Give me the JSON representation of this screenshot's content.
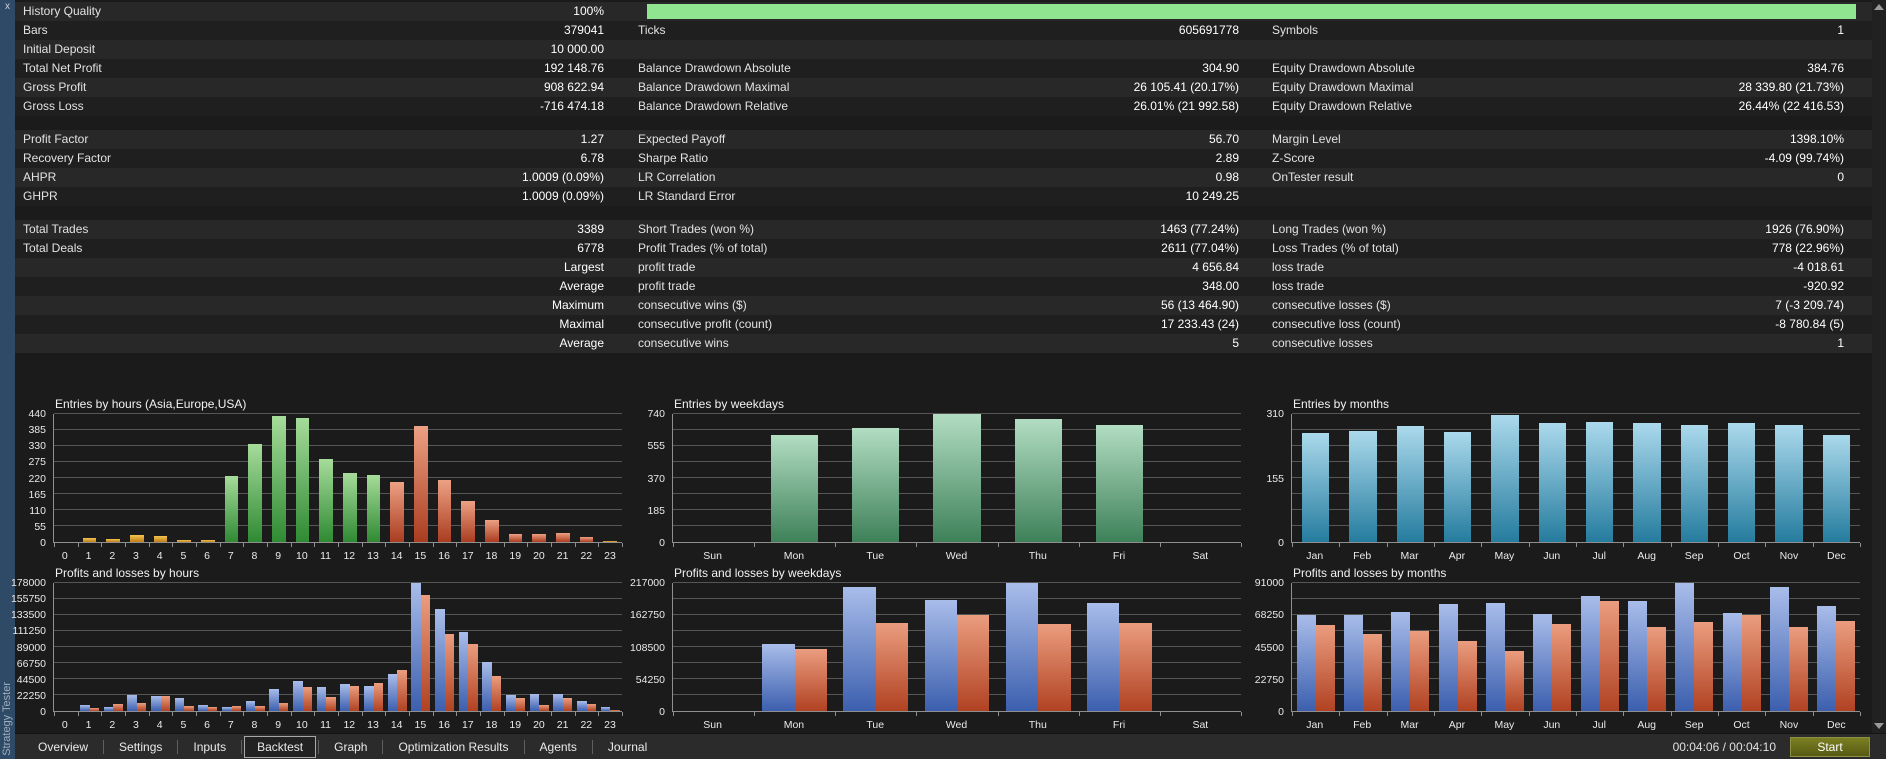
{
  "panel": {
    "title": "Strategy Tester",
    "close_icon": "x"
  },
  "colors": {
    "progress": "#90e690",
    "start_button_top": "#7b7f22",
    "start_button_bottom": "#565a13",
    "bars": {
      "orange": [
        "#f4c551",
        "#bd7d17"
      ],
      "green": [
        "#a6dc9a",
        "#2f8a33"
      ],
      "salmon": [
        "#eda184",
        "#aa3c20"
      ],
      "teal": [
        "#b2ddc2",
        "#3e8159"
      ],
      "cyan": [
        "#abd9ec",
        "#257c9e"
      ],
      "blue": [
        "#a9bdea",
        "#3c5fae"
      ],
      "red": [
        "#eb9d7f",
        "#b04222"
      ]
    }
  },
  "stats": {
    "rows": [
      {
        "progress": true,
        "c1": [
          "History Quality",
          "100%"
        ],
        "c2": [
          "",
          ""
        ],
        "c3": [
          "",
          ""
        ]
      },
      {
        "c1": [
          "Bars",
          "379041"
        ],
        "c2": [
          "Ticks",
          "605691778"
        ],
        "c3": [
          "Symbols",
          "1"
        ]
      },
      {
        "c1": [
          "Initial Deposit",
          "10 000.00"
        ],
        "c2": [
          "",
          ""
        ],
        "c3": [
          "",
          ""
        ]
      },
      {
        "c1": [
          "Total Net Profit",
          "192 148.76"
        ],
        "c2": [
          "Balance Drawdown Absolute",
          "304.90"
        ],
        "c3": [
          "Equity Drawdown Absolute",
          "384.76"
        ]
      },
      {
        "c1": [
          "Gross Profit",
          "908 622.94"
        ],
        "c2": [
          "Balance Drawdown Maximal",
          "26 105.41 (20.17%)"
        ],
        "c3": [
          "Equity Drawdown Maximal",
          "28 339.80 (21.73%)"
        ]
      },
      {
        "c1": [
          "Gross Loss",
          "-716 474.18"
        ],
        "c2": [
          "Balance Drawdown Relative",
          "26.01% (21 992.58)"
        ],
        "c3": [
          "Equity Drawdown Relative",
          "26.44% (22 416.53)"
        ]
      },
      {
        "gap": true
      },
      {
        "c1": [
          "Profit Factor",
          "1.27"
        ],
        "c2": [
          "Expected Payoff",
          "56.70"
        ],
        "c3": [
          "Margin Level",
          "1398.10%"
        ]
      },
      {
        "c1": [
          "Recovery Factor",
          "6.78"
        ],
        "c2": [
          "Sharpe Ratio",
          "2.89"
        ],
        "c3": [
          "Z-Score",
          "-4.09 (99.74%)"
        ]
      },
      {
        "c1": [
          "AHPR",
          "1.0009 (0.09%)"
        ],
        "c2": [
          "LR Correlation",
          "0.98"
        ],
        "c3": [
          "OnTester result",
          "0"
        ]
      },
      {
        "c1": [
          "GHPR",
          "1.0009 (0.09%)"
        ],
        "c2": [
          "LR Standard Error",
          "10 249.25"
        ],
        "c3": [
          "",
          ""
        ]
      },
      {
        "gap": true
      },
      {
        "c1": [
          "Total Trades",
          "3389"
        ],
        "c2": [
          "Short Trades (won %)",
          "1463 (77.24%)"
        ],
        "c3": [
          "Long Trades (won %)",
          "1926 (76.90%)"
        ]
      },
      {
        "c1": [
          "Total Deals",
          "6778"
        ],
        "c2": [
          "Profit Trades (% of total)",
          "2611 (77.04%)"
        ],
        "c3": [
          "Loss Trades (% of total)",
          "778 (22.96%)"
        ]
      },
      {
        "c1": [
          "",
          "Largest"
        ],
        "c2": [
          "profit trade",
          "4 656.84"
        ],
        "c3": [
          "loss trade",
          "-4 018.61"
        ]
      },
      {
        "c1": [
          "",
          "Average"
        ],
        "c2": [
          "profit trade",
          "348.00"
        ],
        "c3": [
          "loss trade",
          "-920.92"
        ]
      },
      {
        "c1": [
          "",
          "Maximum"
        ],
        "c2": [
          "consecutive wins ($)",
          "56 (13 464.90)"
        ],
        "c3": [
          "consecutive losses ($)",
          "7 (-3 209.74)"
        ]
      },
      {
        "c1": [
          "",
          "Maximal"
        ],
        "c2": [
          "consecutive profit (count)",
          "17 233.43 (24)"
        ],
        "c3": [
          "consecutive loss (count)",
          "-8 780.84 (5)"
        ]
      },
      {
        "c1": [
          "",
          "Average"
        ],
        "c2": [
          "consecutive wins",
          "5"
        ],
        "c3": [
          "consecutive losses",
          "1"
        ]
      }
    ]
  },
  "chart_data": [
    {
      "type": "bar",
      "title": "Entries by hours (Asia,Europe,USA)",
      "categories": [
        "0",
        "1",
        "2",
        "3",
        "4",
        "5",
        "6",
        "7",
        "8",
        "9",
        "10",
        "11",
        "12",
        "13",
        "14",
        "15",
        "16",
        "17",
        "18",
        "19",
        "20",
        "21",
        "22",
        "23"
      ],
      "values": [
        0,
        15,
        10,
        25,
        22,
        7,
        8,
        228,
        338,
        432,
        428,
        287,
        238,
        230,
        205,
        400,
        212,
        140,
        75,
        28,
        27,
        32,
        18,
        5
      ],
      "bar_colors": [
        "orange",
        "orange",
        "orange",
        "orange",
        "orange",
        "orange",
        "orange",
        "green",
        "green",
        "green",
        "green",
        "green",
        "green",
        "green",
        "salmon",
        "salmon",
        "salmon",
        "salmon",
        "salmon",
        "salmon",
        "salmon",
        "salmon",
        "salmon",
        "orange"
      ],
      "ymax": 440,
      "yticks": [
        0,
        55,
        110,
        165,
        220,
        275,
        330,
        385,
        440
      ],
      "grid_divisions": 8
    },
    {
      "type": "bar",
      "title": "Entries by weekdays",
      "categories": [
        "Sun",
        "Mon",
        "Tue",
        "Wed",
        "Thu",
        "Fri",
        "Sat"
      ],
      "values": [
        0,
        620,
        660,
        740,
        712,
        675,
        0
      ],
      "color": "teal",
      "ymax": 740,
      "yticks": [
        0,
        185,
        370,
        555,
        740
      ],
      "grid_divisions": 8
    },
    {
      "type": "bar",
      "title": "Entries by months",
      "categories": [
        "Jan",
        "Feb",
        "Mar",
        "Apr",
        "May",
        "Jun",
        "Jul",
        "Aug",
        "Sep",
        "Oct",
        "Nov",
        "Dec"
      ],
      "values": [
        265,
        268,
        282,
        266,
        308,
        288,
        291,
        288,
        284,
        289,
        283,
        260
      ],
      "color": "cyan",
      "ymax": 310,
      "yticks": [
        0,
        155,
        310
      ],
      "grid_divisions": 8
    },
    {
      "type": "bar",
      "title": "Profits and losses by hours",
      "categories": [
        "0",
        "1",
        "2",
        "3",
        "4",
        "5",
        "6",
        "7",
        "8",
        "9",
        "10",
        "11",
        "12",
        "13",
        "14",
        "15",
        "16",
        "17",
        "18",
        "19",
        "20",
        "21",
        "22",
        "23"
      ],
      "series": [
        {
          "name": "profit",
          "color": "blue",
          "values": [
            0,
            9000,
            6000,
            22500,
            20500,
            17500,
            8000,
            5000,
            13500,
            30000,
            41500,
            33500,
            37500,
            34500,
            52000,
            178000,
            142000,
            110500,
            68000,
            22000,
            24000,
            24000,
            14500,
            6000
          ]
        },
        {
          "name": "loss",
          "color": "red",
          "values": [
            0,
            4500,
            9500,
            11500,
            21500,
            7000,
            6000,
            7500,
            7000,
            11500,
            33000,
            20000,
            34500,
            39500,
            56500,
            161000,
            106500,
            93000,
            48000,
            18500,
            8000,
            17500,
            9500,
            1500
          ]
        }
      ],
      "ymax": 178000,
      "yticks": [
        0,
        22250,
        44500,
        66750,
        89000,
        111250,
        133500,
        155750,
        178000
      ],
      "grid_divisions": 8
    },
    {
      "type": "bar",
      "title": "Profits and losses by weekdays",
      "categories": [
        "Sun",
        "Mon",
        "Tue",
        "Wed",
        "Thu",
        "Fri",
        "Sat"
      ],
      "series": [
        {
          "name": "profit",
          "color": "blue",
          "values": [
            0,
            114000,
            210000,
            188000,
            217000,
            183000,
            0
          ]
        },
        {
          "name": "loss",
          "color": "red",
          "values": [
            0,
            105000,
            149000,
            163000,
            148000,
            149000,
            0
          ]
        }
      ],
      "ymax": 217000,
      "yticks": [
        0,
        54250,
        108500,
        162750,
        217000
      ],
      "grid_divisions": 8
    },
    {
      "type": "bar",
      "title": "Profits and losses by months",
      "categories": [
        "Jan",
        "Feb",
        "Mar",
        "Apr",
        "May",
        "Jun",
        "Jul",
        "Aug",
        "Sep",
        "Oct",
        "Nov",
        "Dec"
      ],
      "series": [
        {
          "name": "profit",
          "color": "blue",
          "values": [
            68000,
            68500,
            70500,
            76000,
            77000,
            69000,
            81500,
            78500,
            91000,
            70000,
            88000,
            75000
          ]
        },
        {
          "name": "loss",
          "color": "red",
          "values": [
            61500,
            55000,
            57000,
            49500,
            42500,
            62000,
            78500,
            60000,
            63000,
            68000,
            59500,
            64000
          ]
        }
      ],
      "ymax": 91000,
      "yticks": [
        0,
        22750,
        45500,
        68250,
        91000
      ],
      "grid_divisions": 8
    }
  ],
  "tabs": {
    "items": [
      "Overview",
      "Settings",
      "Inputs",
      "Backtest",
      "Graph",
      "Optimization Results",
      "Agents",
      "Journal"
    ],
    "active": "Backtest"
  },
  "footer": {
    "time": "00:04:06 / 00:04:10",
    "start_label": "Start"
  }
}
